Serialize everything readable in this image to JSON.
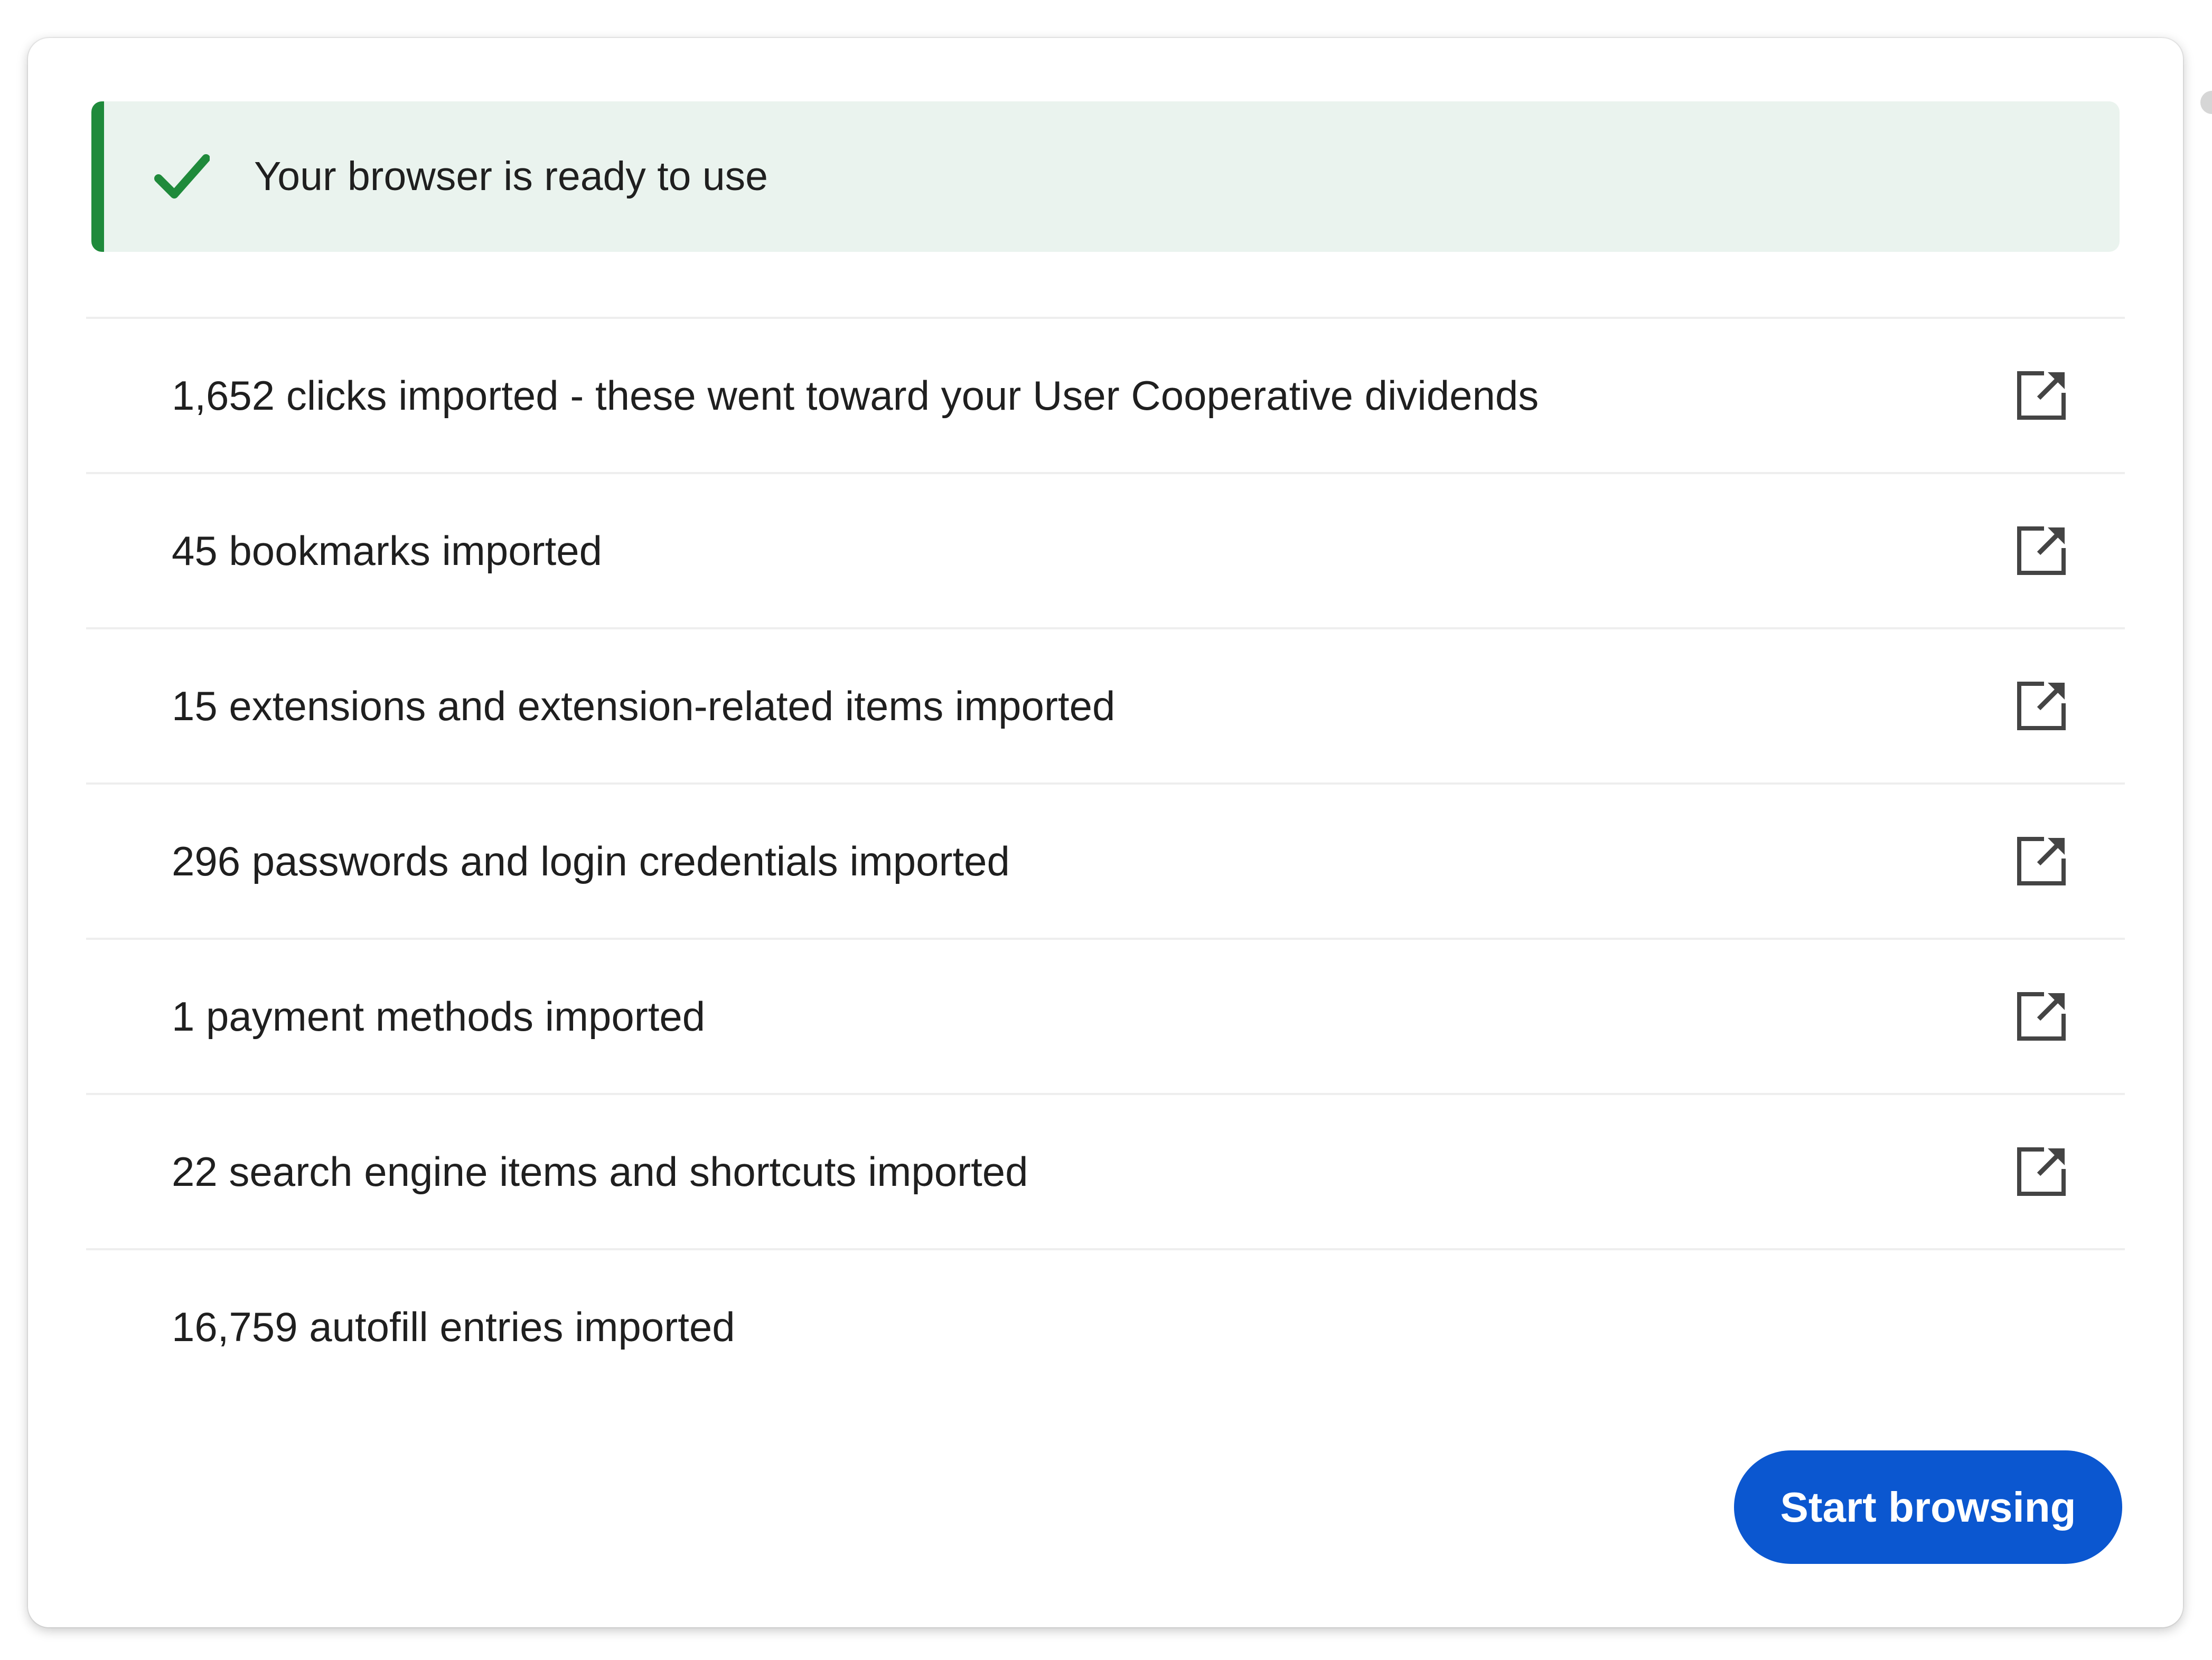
{
  "banner": {
    "icon": "check-icon",
    "text": "Your browser is ready to use",
    "accent_color": "#1f8a3b",
    "background_color": "#eaf3ee"
  },
  "items": [
    {
      "label": "1,652 clicks imported - these went toward your User Cooperative dividends",
      "icon": "open-in-new-icon"
    },
    {
      "label": "45 bookmarks imported",
      "icon": "open-in-new-icon"
    },
    {
      "label": "15 extensions and extension-related items imported",
      "icon": "open-in-new-icon"
    },
    {
      "label": "296 passwords and login credentials imported",
      "icon": "open-in-new-icon"
    },
    {
      "label": "1 payment methods imported",
      "icon": "open-in-new-icon"
    },
    {
      "label": "22 search engine items and shortcuts imported",
      "icon": "open-in-new-icon"
    },
    {
      "label": "16,759 autofill entries imported",
      "icon": null
    }
  ],
  "footer": {
    "start_button_label": "Start browsing",
    "button_color": "#0b57d0"
  }
}
